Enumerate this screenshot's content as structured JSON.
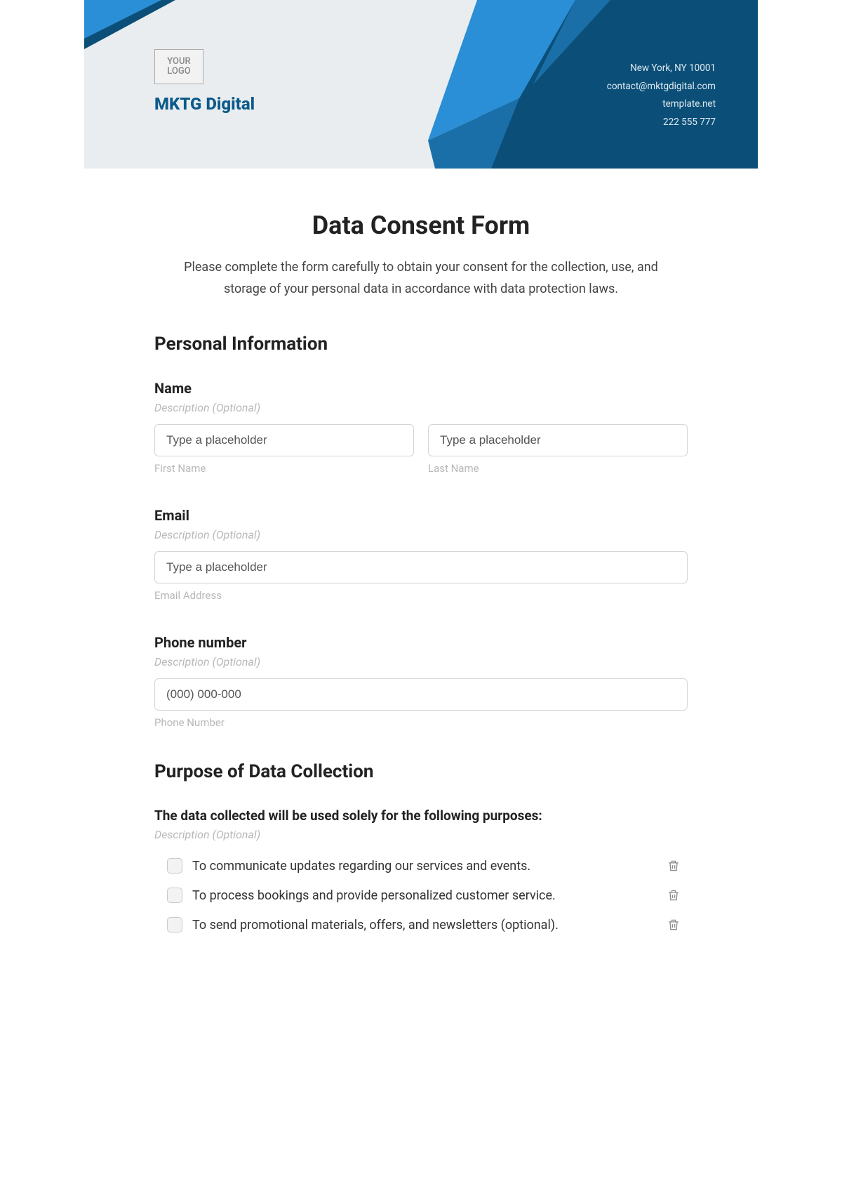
{
  "header": {
    "logo_text": "YOUR LOGO",
    "brand": "MKTG Digital",
    "contact": {
      "address": "New York, NY 10001",
      "email": "contact@mktgdigital.com",
      "site": "template.net",
      "phone": "222 555 777"
    }
  },
  "form": {
    "title": "Data Consent Form",
    "intro": "Please complete the form carefully to obtain your consent for the collection, use, and storage of your personal data in accordance with data protection laws.",
    "sections": {
      "personal": {
        "heading": "Personal Information",
        "name": {
          "label": "Name",
          "desc": "Description (Optional)",
          "first_placeholder": "Type a placeholder",
          "first_sub": "First Name",
          "last_placeholder": "Type a placeholder",
          "last_sub": "Last Name"
        },
        "email": {
          "label": "Email",
          "desc": "Description (Optional)",
          "placeholder": "Type a placeholder",
          "sub": "Email Address"
        },
        "phone": {
          "label": "Phone number",
          "desc": "Description (Optional)",
          "placeholder": "(000) 000-000",
          "sub": "Phone Number"
        }
      },
      "purpose": {
        "heading": "Purpose of Data Collection",
        "intro": "The data collected will be used solely for the following purposes:",
        "desc": "Description (Optional)",
        "items": [
          "To communicate updates regarding our services and events.",
          "To process bookings and provide personalized customer service.",
          "To send promotional materials, offers, and newsletters (optional)."
        ]
      }
    }
  }
}
